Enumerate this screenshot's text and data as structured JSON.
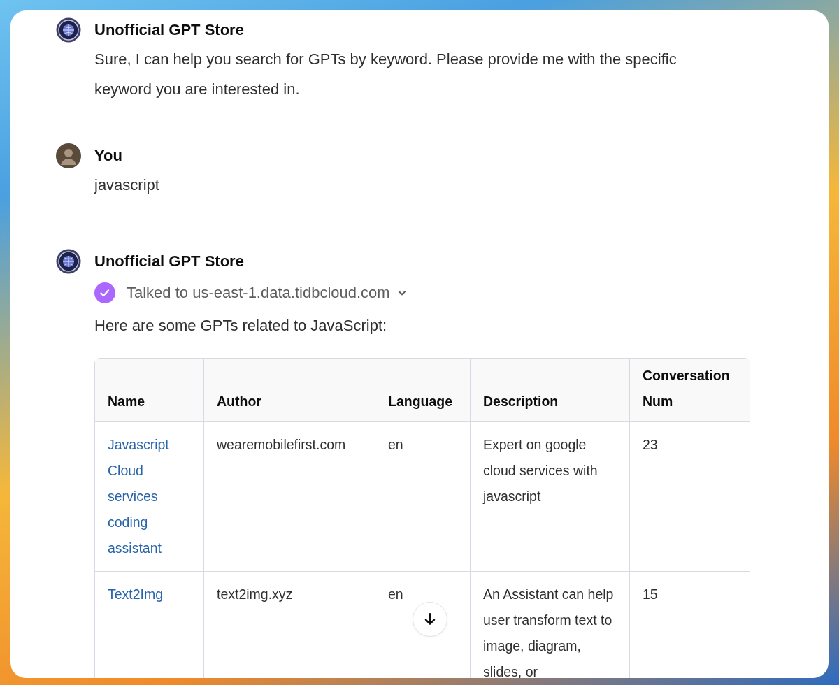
{
  "messages": [
    {
      "kind": "assistant",
      "author": "Unofficial GPT Store",
      "text": "Sure, I can help you search for GPTs by keyword. Please provide me with the specific keyword you are interested in."
    },
    {
      "kind": "user",
      "author": "You",
      "text": "javascript"
    },
    {
      "kind": "assistant",
      "author": "Unofficial GPT Store",
      "tool_call": {
        "text": "Talked to us-east-1.data.tidbcloud.com",
        "expanded": false
      },
      "text": "Here are some GPTs related to JavaScript:",
      "table": {
        "columns": [
          "Name",
          "Author",
          "Language",
          "Description",
          "Conversation Num"
        ],
        "rows": [
          [
            "Javascript Cloud services coding assistant",
            "wearemobilefirst.com",
            "en",
            "Expert on google cloud services with javascript",
            "23"
          ],
          [
            "Text2Img",
            "text2img.xyz",
            "en",
            "An Assistant can help user transform text to image, diagram, slides, or",
            "15"
          ]
        ]
      }
    }
  ]
}
